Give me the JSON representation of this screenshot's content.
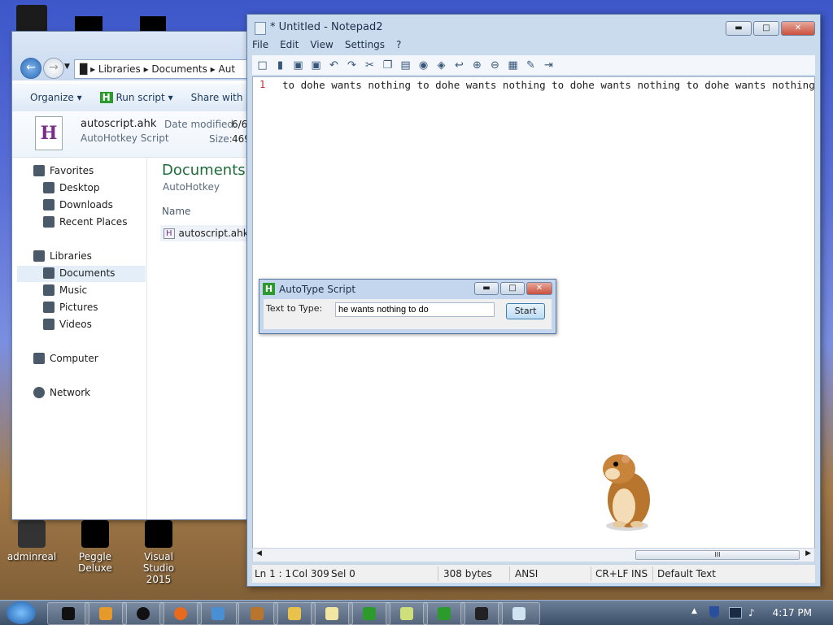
{
  "desktop": {
    "icons": [
      {
        "label": "adminreal"
      },
      {
        "label": "Peggle Deluxe"
      },
      {
        "label": "Visual Studio 2015"
      }
    ]
  },
  "explorer": {
    "breadcrumb": [
      "Libraries",
      "Documents",
      "Aut"
    ],
    "commands": {
      "organize": "Organize",
      "run_script": "Run script",
      "share_with": "Share with"
    },
    "details": {
      "filename": "autoscript.ahk",
      "filetype": "AutoHotkey Script",
      "date_label": "Date modified:",
      "date_value": "6/6",
      "size_label": "Size:",
      "size_value": "469"
    },
    "nav": {
      "favorites": "Favorites",
      "desktop": "Desktop",
      "downloads": "Downloads",
      "recent": "Recent Places",
      "libraries": "Libraries",
      "documents": "Documents",
      "music": "Music",
      "pictures": "Pictures",
      "videos": "Videos",
      "computer": "Computer",
      "network": "Network"
    },
    "content": {
      "heading": "Documents l",
      "subheading": "AutoHotkey",
      "column_name": "Name",
      "file": "autoscript.ahk"
    }
  },
  "notepad": {
    "title": "* Untitled - Notepad2",
    "menu": [
      "File",
      "Edit",
      "View",
      "Settings",
      "?"
    ],
    "line_number": "1",
    "text": "to dohe wants nothing to dohe wants nothing to dohe wants nothing to dohe wants nothing to do",
    "scroll_thumb": "III",
    "status": {
      "ln": "Ln 1 : 1",
      "col": "Col 309",
      "sel": "Sel 0",
      "bytes": "308 bytes",
      "encoding": "ANSI",
      "eol": "CR+LF",
      "ins": "INS",
      "scheme": "Default Text"
    }
  },
  "autotype": {
    "title": "AutoType Script",
    "label": "Text to Type:",
    "input_value": "he wants nothing to do",
    "start_button": "Start"
  },
  "taskbar": {
    "clock": "4:17 PM"
  }
}
